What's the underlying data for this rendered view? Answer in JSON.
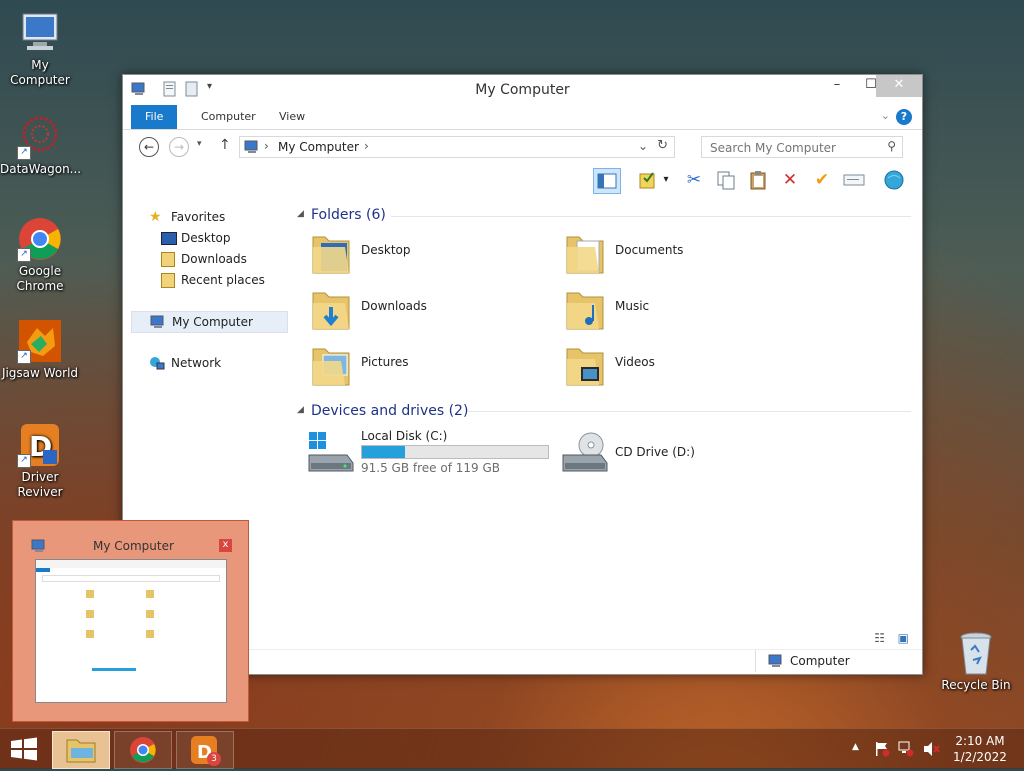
{
  "desktop": {
    "icons": [
      {
        "label": "My Computer"
      },
      {
        "label": "DataWagon..."
      },
      {
        "label": "Google Chrome"
      },
      {
        "label": "Jigsaw World"
      },
      {
        "label": "Driver Reviver"
      },
      {
        "label": "Recycle Bin"
      }
    ]
  },
  "window": {
    "title": "My Computer",
    "controls": {
      "minimize": "–",
      "maximize": "☐",
      "close": "✕"
    },
    "ribbon": {
      "tabs": [
        "File",
        "Computer",
        "View"
      ]
    },
    "address": {
      "path": "My Computer",
      "separator": "›"
    },
    "search": {
      "placeholder": "Search My Computer"
    },
    "nav": {
      "favorites": "Favorites",
      "items": [
        "Desktop",
        "Downloads",
        "Recent places"
      ],
      "my_computer": "My Computer",
      "network": "Network"
    },
    "folders_group": {
      "title": "Folders (6)",
      "items": [
        "Desktop",
        "Documents",
        "Downloads",
        "Music",
        "Pictures",
        "Videos"
      ]
    },
    "drives_group": {
      "title": "Devices and drives (2)",
      "local_disk": {
        "name": "Local Disk (C:)",
        "free_text": "91.5 GB free of 119 GB",
        "used_fraction": 0.23
      },
      "cd_drive": {
        "name": "CD Drive (D:)"
      }
    },
    "status": {
      "location": "Computer"
    }
  },
  "preview": {
    "title": "My Computer",
    "close": "x"
  },
  "taskbar": {
    "clock_time": "2:10 AM",
    "clock_date": "1/2/2022",
    "badge": "3",
    "tray_arrow": "▲"
  },
  "colors": {
    "file_tab": "#1979ca",
    "group_heading": "#1e3287",
    "progress": "#26a0da"
  }
}
